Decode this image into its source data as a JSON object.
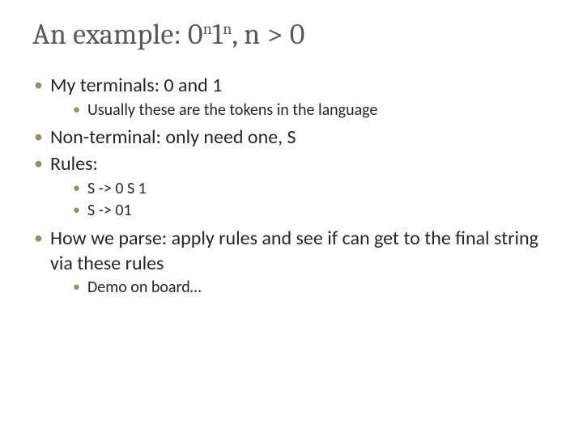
{
  "title": {
    "prefix": "An example: 0",
    "sup1": "n",
    "mid": "1",
    "sup2": "n",
    "suffix": ", n > 0"
  },
  "bullets": {
    "b1": "My terminals: 0 and 1",
    "b1_1": "Usually these are the tokens in the language",
    "b2": "Non-terminal: only need one, S",
    "b3": "Rules:",
    "b3_1": "S -> 0 S 1",
    "b3_2": "S -> 01",
    "b4": "How we parse: apply rules and see if can get to the final string via these rules",
    "b4_1": "Demo on board…"
  }
}
